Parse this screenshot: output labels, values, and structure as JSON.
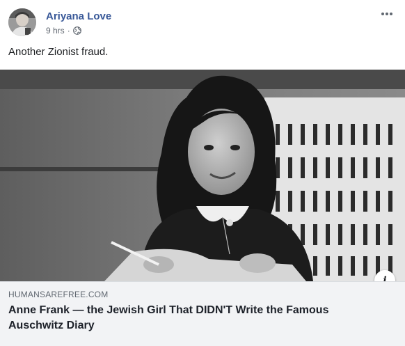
{
  "post": {
    "author": "Ariyana Love",
    "time": "9 hrs",
    "separator": "·",
    "privacy_icon": "globe-icon",
    "more_icon": "more-options-icon",
    "text": "Another Zionist fraud."
  },
  "link_preview": {
    "domain": "HUMANSAREFREE.COM",
    "title": "Anne Frank — the Jewish Girl That DIDN'T Write the Famous Auschwitz Diary",
    "info_label": "i",
    "image": "black-and-white photo of a smiling girl seated at a desk, writing"
  },
  "colors": {
    "author_link": "#385898",
    "meta_text": "#606770",
    "link_bar_bg": "#f2f3f5"
  }
}
